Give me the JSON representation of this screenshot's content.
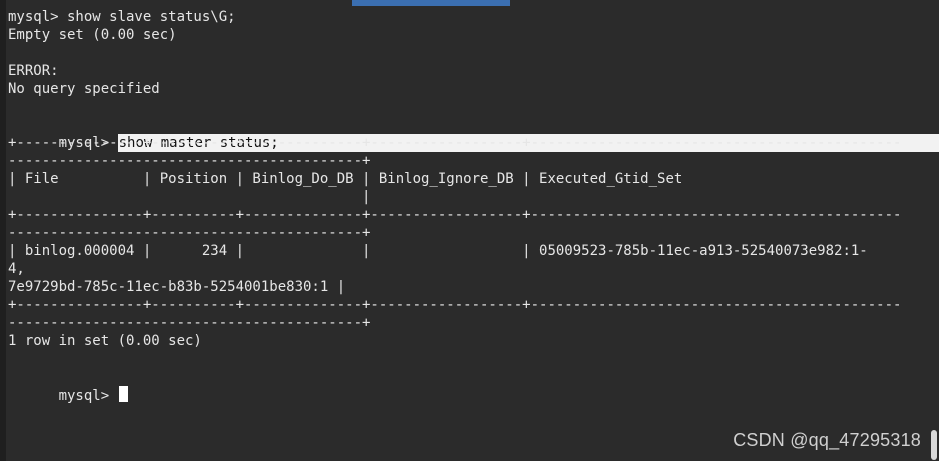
{
  "lines": [
    {
      "text": "mysql> show slave status\\G;"
    },
    {
      "text": "Empty set (0.00 sec)"
    },
    {
      "text": ""
    },
    {
      "text": "ERROR:"
    },
    {
      "text": "No query specified"
    },
    {
      "text": ""
    },
    {
      "prompt": "mysql> ",
      "selected_text": "show master status;"
    },
    {
      "text": "+---------------+----------+--------------+------------------+--------------------------------------------"
    },
    {
      "text": "------------------------------------------+"
    },
    {
      "text": "| File          | Position | Binlog_Do_DB | Binlog_Ignore_DB | Executed_Gtid_Set"
    },
    {
      "text": "                                          |"
    },
    {
      "text": "+---------------+----------+--------------+------------------+--------------------------------------------"
    },
    {
      "text": "------------------------------------------+"
    },
    {
      "text": "| binlog.000004 |      234 |              |                  | 05009523-785b-11ec-a913-52540073e982:1-"
    },
    {
      "text": "4,"
    },
    {
      "text": "7e9729bd-785c-11ec-b83b-5254001be830:1 |"
    },
    {
      "text": "+---------------+----------+--------------+------------------+--------------------------------------------"
    },
    {
      "text": "------------------------------------------+"
    },
    {
      "text": "1 row in set (0.00 sec)"
    },
    {
      "text": ""
    },
    {
      "prompt": "mysql> "
    }
  ],
  "watermark": "CSDN @qq_47295318",
  "colors": {
    "background": "#2b2b2b",
    "text": "#e6e6e6",
    "selection_bg": "#f2f2f2",
    "accent": "#3b6fb1"
  }
}
